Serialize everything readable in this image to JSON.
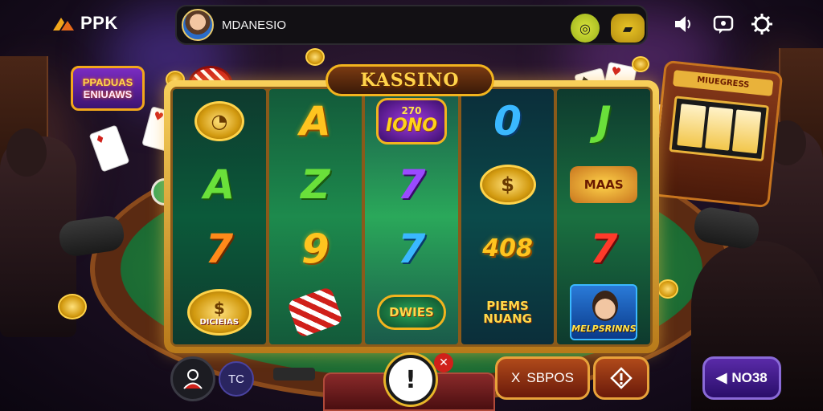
{
  "app": {
    "logo_text": "PPK"
  },
  "player": {
    "name": "MDANESIO"
  },
  "promo_sign": {
    "line1": "PPADUAS",
    "line2": "ENIUAWS"
  },
  "machine": {
    "title": "KASSINO",
    "cabinet_label": "MIUEGRESS"
  },
  "reels": [
    {
      "symbols": [
        "coin",
        "A",
        "7",
        "slot-bag"
      ]
    },
    {
      "symbols": [
        "A",
        "Z",
        "9",
        "candy"
      ]
    },
    {
      "symbols": [
        "270 IONO",
        "7",
        "7",
        "DWIES"
      ]
    },
    {
      "symbols": [
        "0",
        "coin",
        "408",
        "PIEMS NUANG"
      ]
    },
    {
      "symbols": [
        "J",
        "MAAS",
        "7",
        "MELPSRINNS"
      ]
    }
  ],
  "symbol_text": {
    "r1_bottom": "DICIEIAS",
    "r3_badge_top": "270",
    "r3_badge_bottom": "IONO",
    "r3_bottom": "DWIES",
    "r4_mid": "408",
    "r4_bottom_1": "PIEMS",
    "r4_bottom_2": "NUANG",
    "r5_top_mid": "MAAS",
    "r5_portrait": "MELPSRINNS"
  },
  "controls": {
    "tc_label": "TC",
    "alert_label": "!",
    "spins_icon": "X",
    "spins_label": "SBPOS",
    "rhombus_icon": "!",
    "mode_label": "NO38"
  },
  "colors": {
    "accent_gold": "#f2b41e",
    "felt_green": "#1c6b33",
    "mode_purple": "#5a2aa8"
  }
}
